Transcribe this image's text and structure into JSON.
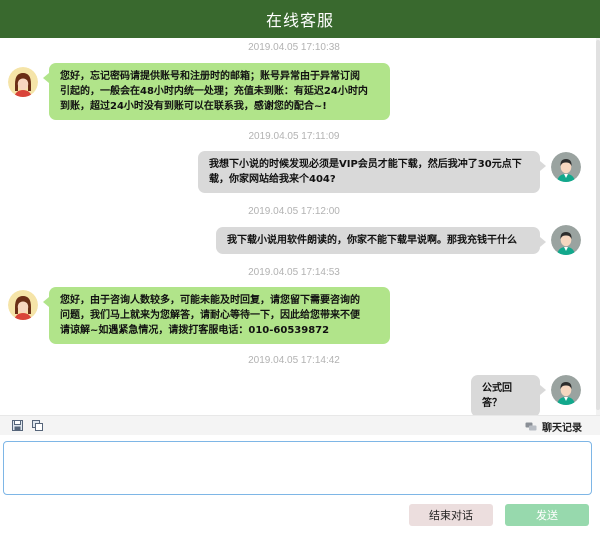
{
  "header": {
    "title": "在线客服"
  },
  "messages": [
    {
      "side": "left",
      "timestamp": "2019.04.05 17:10:38",
      "lines": [
        "您好，忘记密码请提供账号和注册时的邮箱；账号异常由于异常订阅",
        "引起的，一般会在48小时内统一处理；充值未到账：有延迟24小时内",
        "到账，超过24小时没有到账可以在联系我，感谢您的配合~!"
      ]
    },
    {
      "side": "right",
      "timestamp": "2019.04.05 17:11:09",
      "lines": [
        "我想下小说的时候发现必须是VIP会员才能下载，然后我冲了30元点下",
        "载，你家网站给我来个404?"
      ]
    },
    {
      "side": "right",
      "timestamp": "2019.04.05 17:12:00",
      "lines": [
        "我下载小说用软件朗读的，你家不能下载早说啊。那我充钱干什么"
      ]
    },
    {
      "side": "left",
      "timestamp": "2019.04.05 17:14:53",
      "lines": [
        "您好，由于咨询人数较多，可能未能及时回复，请您留下需要咨询的",
        "问题，我们马上就来为您解答，请耐心等待一下，因此给您带来不便",
        "请谅解~如遇紧急情况，请拨打客服电话：010-60539872"
      ]
    },
    {
      "side": "right",
      "timestamp": "2019.04.05 17:14:42",
      "lines": [
        "公式回答？"
      ]
    }
  ],
  "toolbar": {
    "history_label": "聊天记录"
  },
  "input": {
    "value": ""
  },
  "buttons": {
    "end_label": "结束对话",
    "send_label": "发送"
  },
  "colors": {
    "header_bg": "#39692e",
    "agent_bubble": "#b1e48a",
    "user_bubble": "#d9d9d9",
    "send_button": "#97d9ad",
    "end_button": "#ecdede"
  }
}
